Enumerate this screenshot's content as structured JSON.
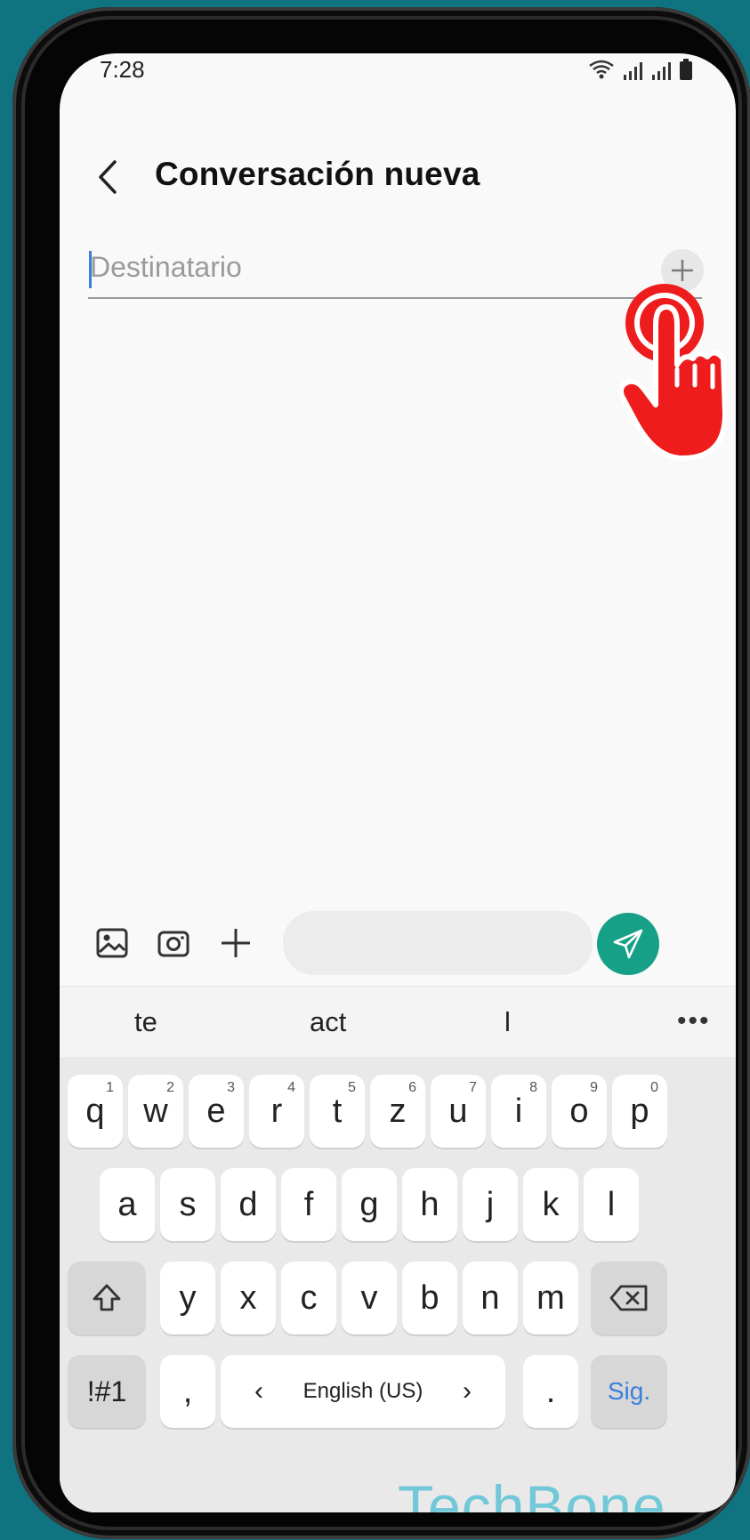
{
  "status_bar": {
    "time": "7:28"
  },
  "app_bar": {
    "title": "Conversación nueva"
  },
  "recipient": {
    "placeholder": "Destinatario",
    "value": ""
  },
  "compose": {
    "placeholder": ""
  },
  "suggestions": [
    "te",
    "act",
    "l"
  ],
  "keyboard": {
    "row1": [
      {
        "k": "q",
        "s": "1"
      },
      {
        "k": "w",
        "s": "2"
      },
      {
        "k": "e",
        "s": "3"
      },
      {
        "k": "r",
        "s": "4"
      },
      {
        "k": "t",
        "s": "5"
      },
      {
        "k": "z",
        "s": "6"
      },
      {
        "k": "u",
        "s": "7"
      },
      {
        "k": "i",
        "s": "8"
      },
      {
        "k": "o",
        "s": "9"
      },
      {
        "k": "p",
        "s": "0"
      }
    ],
    "row2": [
      "a",
      "s",
      "d",
      "f",
      "g",
      "h",
      "j",
      "k",
      "l"
    ],
    "row3": [
      "y",
      "x",
      "c",
      "v",
      "b",
      "n",
      "m"
    ],
    "symbols": "!#1",
    "comma": ",",
    "space_language": "English (US)",
    "period": ".",
    "action": "Sig."
  },
  "watermark": "TechBone",
  "colors": {
    "accent": "#17a088",
    "caret": "#3b7fdc",
    "pointer": "#ee1c1c",
    "background": "#0f7480"
  },
  "icons": [
    "back-arrow-icon",
    "plus-icon",
    "gallery-icon",
    "camera-icon",
    "send-icon",
    "shift-icon",
    "backspace-icon"
  ]
}
